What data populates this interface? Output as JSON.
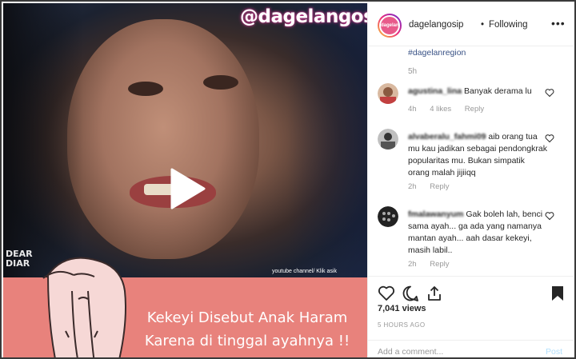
{
  "post": {
    "watermark": "@dagelangosip",
    "banner_line1": "Kekeyi Disebut Anak Haram",
    "banner_line2": "Karena di tinggal ayahnya !!",
    "corner_logo": "DEAR DIAR",
    "youtube_credit": "youtube channel/ Klik asik"
  },
  "header": {
    "avatar_text": "dagelan",
    "username": "dagelangosip",
    "separator": "•",
    "follow_status": "Following",
    "more": "•••"
  },
  "caption": {
    "hashtag": "#dagelanregion",
    "time": "5h"
  },
  "comments": [
    {
      "username": "agustina_lina",
      "text": "Banyak derama lu",
      "time": "4h",
      "likes": "4 likes",
      "reply": "Reply"
    },
    {
      "username": "alvaberalu_fahmi09",
      "text": "aib orang tua mu kau jadikan sebagai pendongkrak popularitas mu. Bukan simpatik orang malah jijiiqq",
      "time": "2h",
      "likes": "",
      "reply": "Reply"
    },
    {
      "username": "fmalawanyum",
      "text": "Gak boleh lah, benci sama ayah... ga ada yang namanya mantan ayah... aah dasar kekeyi, masih labil..",
      "time": "2h",
      "likes": "",
      "reply": "Reply"
    }
  ],
  "stats": {
    "views": "7,041 views",
    "posted": "5 HOURS AGO"
  },
  "composer": {
    "placeholder": "Add a comment...",
    "post_label": "Post"
  },
  "colors": {
    "banner": "#e8827c",
    "link": "#385185",
    "muted": "#999999",
    "post_disabled": "#b2dffc"
  }
}
